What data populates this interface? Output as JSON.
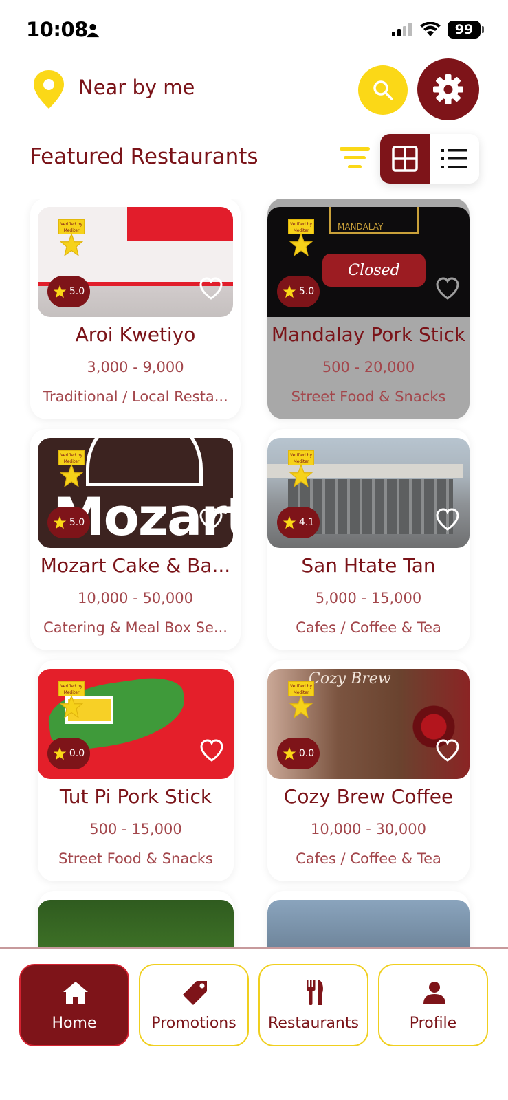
{
  "status_bar": {
    "time": "10:08",
    "battery": "99",
    "icons": [
      "person-icon",
      "signal-icon",
      "wifi-icon",
      "battery-icon"
    ]
  },
  "header": {
    "location_label": "Near by me",
    "location_icon": "location-pin-icon",
    "search_icon": "search-icon",
    "settings_icon": "gear-icon"
  },
  "section": {
    "title": "Featured Restaurants",
    "filter_icon": "filter-icon",
    "view_grid_icon": "grid-view-icon",
    "view_list_icon": "list-view-icon",
    "active_view": "grid"
  },
  "restaurants": [
    {
      "name": "Aroi Kwetiyo",
      "price": "3,000 - 9,000",
      "category": "Traditional / Local Resta...",
      "rating": "5.0",
      "closed": false
    },
    {
      "name": "Mandalay Pork Stick",
      "price": "500 - 20,000",
      "category": "Street Food & Snacks",
      "rating": "5.0",
      "closed": true,
      "closed_label": "Closed",
      "image_text": "MANDALAY"
    },
    {
      "name": "Mozart Cake & Ba...",
      "price": "10,000 - 50,000",
      "category": "Catering & Meal Box Se...",
      "rating": "5.0",
      "closed": false,
      "image_text": "Mozart"
    },
    {
      "name": "San Htate Tan",
      "price": "5,000 - 15,000",
      "category": "Cafes / Coffee & Tea",
      "rating": "4.1",
      "closed": false
    },
    {
      "name": "Tut Pi Pork Stick",
      "price": "500 - 15,000",
      "category": "Street Food & Snacks",
      "rating": "0.0",
      "closed": false
    },
    {
      "name": "Cozy Brew Coffee",
      "price": "10,000 - 30,000",
      "category": "Cafes / Coffee & Tea",
      "rating": "0.0",
      "closed": false,
      "image_text": "Cozy Brew"
    }
  ],
  "badge": {
    "verified_text": "Verified by Mediter"
  },
  "nav": {
    "items": [
      {
        "label": "Home",
        "icon": "home-icon",
        "active": true
      },
      {
        "label": "Promotions",
        "icon": "tag-icon",
        "active": false
      },
      {
        "label": "Restaurants",
        "icon": "fork-knife-icon",
        "active": false
      },
      {
        "label": "Profile",
        "icon": "user-icon",
        "active": false
      }
    ]
  },
  "colors": {
    "primary": "#7e1419",
    "accent": "#fbd817",
    "text": "#7a1318",
    "muted_text": "#a3474c",
    "closed_overlay": "#a8a8a8"
  }
}
